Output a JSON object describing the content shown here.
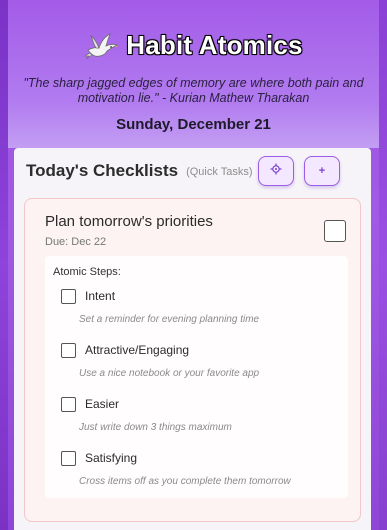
{
  "header": {
    "app_title": "Habit Atomics",
    "quote": "\"The sharp jagged edges of memory are where both pain and motivation lie.\" - Kurian Mathew Tharakan",
    "date": "Sunday, December 21"
  },
  "checklists": {
    "title": "Today's Checklists",
    "subtitle": "(Quick Tasks)",
    "settings_icon": "gear-icon",
    "add_label": "+"
  },
  "habit": {
    "name": "Plan tomorrow's priorities",
    "due": "Due: Dec 22",
    "steps_label": "Atomic Steps:",
    "steps": [
      {
        "title": "Intent",
        "desc": "Set a reminder for evening planning time"
      },
      {
        "title": "Attractive/Engaging",
        "desc": "Use a nice notebook or your favorite app"
      },
      {
        "title": "Easier",
        "desc": "Just write down 3 things maximum"
      },
      {
        "title": "Satisfying",
        "desc": "Cross items off as you complete them tomorrow"
      }
    ]
  },
  "colors": {
    "header_purple": "#a35be8",
    "accent": "#9b5de5",
    "card_bg": "#fdf3f3",
    "card_border": "#f1c7c7"
  }
}
